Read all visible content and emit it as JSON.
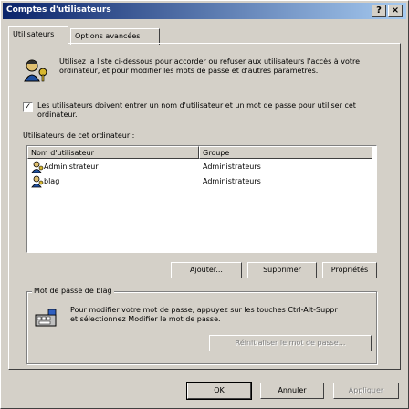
{
  "window": {
    "title": "Comptes d'utilisateurs",
    "help_label": "?",
    "close_label": "×"
  },
  "tabs": [
    {
      "label": "Utilisateurs"
    },
    {
      "label": "Options avancées"
    }
  ],
  "intro": {
    "text": "Utilisez la liste ci-dessous pour accorder ou refuser aux utilisateurs l'accès à votre ordinateur, et pour modifier les mots de passe et d'autres paramètres.",
    "icon": "users-keys-icon"
  },
  "checkbox": {
    "checked": true,
    "label": "Les utilisateurs doivent entrer un nom d'utilisateur et un mot de passe pour utiliser cet ordinateur."
  },
  "users_section": {
    "label": "Utilisateurs de cet ordinateur :",
    "columns": [
      "Nom d'utilisateur",
      "Groupe"
    ],
    "rows": [
      {
        "name": "Administrateur",
        "group": "Administrateurs"
      },
      {
        "name": "blag",
        "group": "Administrateurs"
      }
    ]
  },
  "list_buttons": {
    "add": "Ajouter...",
    "remove": "Supprimer",
    "properties": "Propriétés"
  },
  "password_group": {
    "label": "Mot de passe de blag",
    "text": "Pour modifier votre mot de passe, appuyez sur les touches Ctrl-Alt-Suppr et sélectionnez Modifier le mot de passe.",
    "reset_button": "Réinitialiser le mot de passe..."
  },
  "footer": {
    "ok": "OK",
    "cancel": "Annuler",
    "apply": "Appliquer"
  }
}
